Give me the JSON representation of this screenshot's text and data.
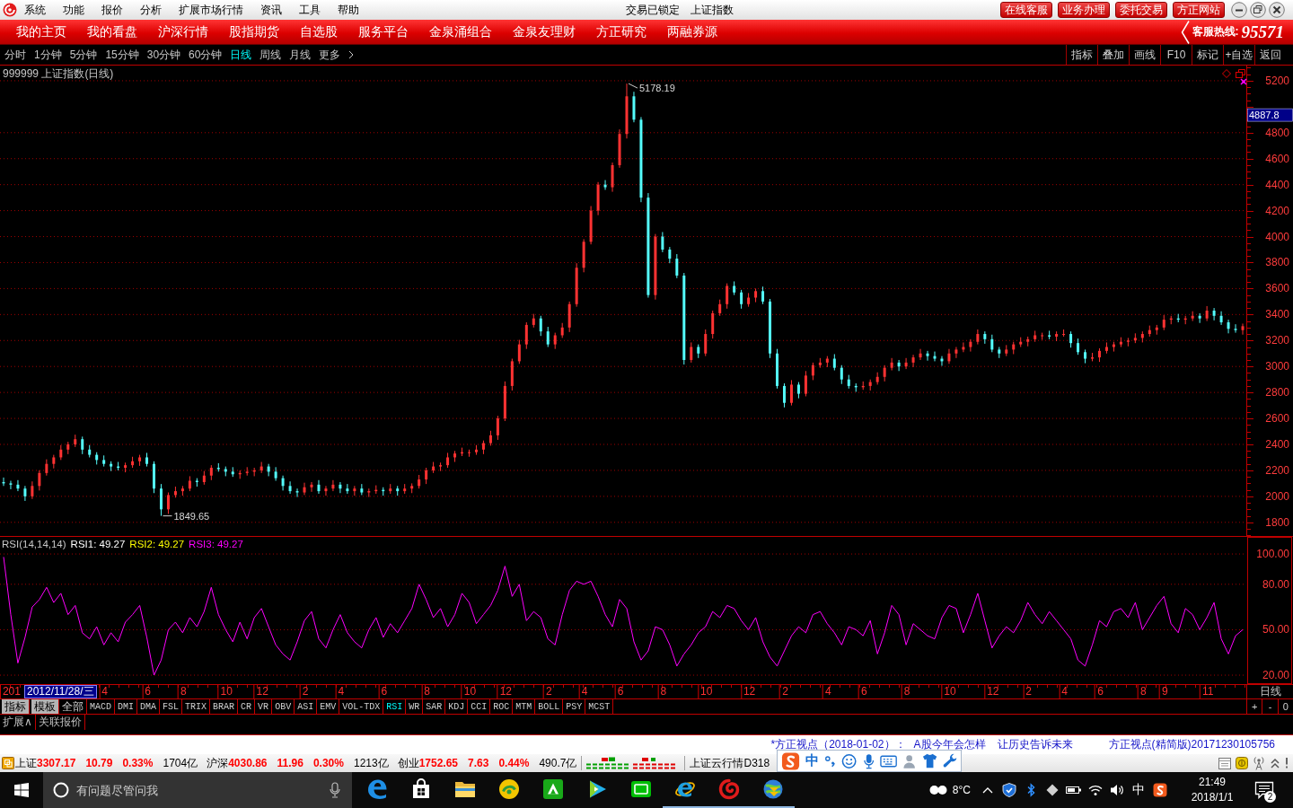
{
  "title_bar": {
    "menu": [
      "系统",
      "功能",
      "报价",
      "分析",
      "扩展市场行情",
      "资讯",
      "工具",
      "帮助"
    ],
    "lock_status": "交易已锁定",
    "security": "上证指数",
    "service_buttons": [
      "在线客服",
      "业务办理",
      "委托交易",
      "方正网站"
    ]
  },
  "nav_bar": {
    "items": [
      "我的主页",
      "我的看盘",
      "沪深行情",
      "股指期货",
      "自选股",
      "服务平台",
      "金泉涌组合",
      "金泉友理财",
      "方正研究",
      "两融券源"
    ],
    "hotline_label": "客服热线:",
    "hotline_number": "95571"
  },
  "period_bar": {
    "periods": [
      {
        "label": "分时",
        "selected": false
      },
      {
        "label": "1分钟",
        "selected": false
      },
      {
        "label": "5分钟",
        "selected": false
      },
      {
        "label": "15分钟",
        "selected": false
      },
      {
        "label": "30分钟",
        "selected": false
      },
      {
        "label": "60分钟",
        "selected": false
      },
      {
        "label": "日线",
        "selected": true
      },
      {
        "label": "周线",
        "selected": false
      },
      {
        "label": "月线",
        "selected": false
      },
      {
        "label": "更多",
        "selected": false
      }
    ],
    "tools": [
      "指标",
      "叠加",
      "画线",
      "F10",
      "标记",
      "+自选",
      "返回"
    ]
  },
  "price_chart": {
    "cursor_value": "4887.8",
    "chart_data": {
      "type": "candlestick",
      "title": "999999 上证指数(日线)",
      "categories": [
        null,
        null,
        null,
        null,
        null,
        null,
        null,
        null,
        null,
        null,
        null,
        null,
        null,
        null,
        null,
        null,
        null,
        null,
        null,
        null,
        null,
        null,
        null,
        null,
        null,
        null,
        null,
        null,
        null,
        null,
        null,
        null,
        null,
        null,
        null,
        null,
        null,
        null,
        null,
        null,
        null,
        null,
        null,
        null,
        null,
        null,
        null,
        null,
        null,
        null,
        null,
        null,
        null,
        null,
        null,
        null,
        null,
        null,
        null,
        null,
        null,
        null,
        null,
        null,
        null,
        null,
        null,
        null,
        null,
        null,
        null,
        null,
        null,
        null,
        null,
        null,
        null,
        null,
        null,
        null,
        null,
        null,
        null,
        null,
        null,
        null,
        null,
        null,
        null,
        null,
        null,
        null,
        null,
        null,
        null,
        null,
        null,
        null,
        null,
        null,
        null,
        null,
        null,
        null,
        null,
        null,
        null,
        null,
        null,
        null,
        null,
        null,
        null,
        null,
        null,
        null,
        null,
        null,
        null,
        null,
        null,
        null,
        null,
        null,
        null,
        null,
        null,
        null,
        null,
        null,
        null,
        null,
        null,
        null,
        null,
        null,
        null,
        null,
        null,
        null,
        null,
        null,
        null,
        null,
        null,
        null,
        null,
        null,
        null,
        null,
        null,
        null,
        null,
        null,
        null,
        null,
        null,
        null,
        null,
        null,
        null,
        null,
        null,
        null,
        null,
        null,
        null,
        null,
        null,
        null,
        null,
        null,
        null,
        null
      ],
      "ohlc": [
        [
          2110,
          2145,
          2080,
          2100
        ],
        [
          2100,
          2120,
          2055,
          2090
        ],
        [
          2090,
          2125,
          2040,
          2060
        ],
        [
          2060,
          2080,
          1965,
          2000
        ],
        [
          2000,
          2115,
          1980,
          2080
        ],
        [
          2080,
          2200,
          2045,
          2180
        ],
        [
          2180,
          2285,
          2160,
          2250
        ],
        [
          2250,
          2320,
          2215,
          2300
        ],
        [
          2300,
          2395,
          2280,
          2360
        ],
        [
          2360,
          2420,
          2325,
          2400
        ],
        [
          2400,
          2475,
          2380,
          2440
        ],
        [
          2440,
          2460,
          2325,
          2360
        ],
        [
          2360,
          2395,
          2300,
          2320
        ],
        [
          2320,
          2340,
          2245,
          2280
        ],
        [
          2280,
          2315,
          2230,
          2250
        ],
        [
          2250,
          2270,
          2195,
          2230
        ],
        [
          2230,
          2265,
          2200,
          2220
        ],
        [
          2220,
          2260,
          2185,
          2240
        ],
        [
          2240,
          2305,
          2220,
          2270
        ],
        [
          2270,
          2320,
          2235,
          2300
        ],
        [
          2300,
          2335,
          2230,
          2250
        ],
        [
          2250,
          2270,
          2025,
          2060
        ],
        [
          2060,
          2095,
          1849.65,
          1900
        ],
        [
          1900,
          2030,
          1865,
          2010
        ],
        [
          2010,
          2075,
          1990,
          2040
        ],
        [
          2040,
          2080,
          2005,
          2060
        ],
        [
          2060,
          2155,
          2040,
          2120
        ],
        [
          2120,
          2140,
          2075,
          2110
        ],
        [
          2110,
          2195,
          2090,
          2160
        ],
        [
          2160,
          2240,
          2125,
          2220
        ],
        [
          2220,
          2255,
          2190,
          2210
        ],
        [
          2210,
          2230,
          2155,
          2190
        ],
        [
          2190,
          2225,
          2150,
          2170
        ],
        [
          2170,
          2200,
          2135,
          2180
        ],
        [
          2180,
          2225,
          2160,
          2190
        ],
        [
          2190,
          2220,
          2155,
          2200
        ],
        [
          2200,
          2265,
          2180,
          2230
        ],
        [
          2230,
          2250,
          2155,
          2190
        ],
        [
          2190,
          2225,
          2120,
          2140
        ],
        [
          2140,
          2160,
          2045,
          2080
        ],
        [
          2080,
          2115,
          2020,
          2040
        ],
        [
          2040,
          2060,
          1995,
          2030
        ],
        [
          2030,
          2105,
          2010,
          2070
        ],
        [
          2070,
          2110,
          2035,
          2090
        ],
        [
          2090,
          2125,
          2020,
          2040
        ],
        [
          2040,
          2080,
          2005,
          2060
        ],
        [
          2060,
          2125,
          2040,
          2090
        ],
        [
          2090,
          2110,
          2025,
          2060
        ],
        [
          2060,
          2095,
          2020,
          2040
        ],
        [
          2040,
          2080,
          2005,
          2060
        ],
        [
          2060,
          2095,
          2010,
          2030
        ],
        [
          2030,
          2060,
          1995,
          2040
        ],
        [
          2040,
          2085,
          2020,
          2050
        ],
        [
          2050,
          2070,
          2005,
          2040
        ],
        [
          2040,
          2095,
          2020,
          2060
        ],
        [
          2060,
          2080,
          2005,
          2040
        ],
        [
          2040,
          2095,
          2020,
          2060
        ],
        [
          2060,
          2100,
          2025,
          2080
        ],
        [
          2080,
          2165,
          2060,
          2130
        ],
        [
          2130,
          2220,
          2095,
          2200
        ],
        [
          2200,
          2265,
          2180,
          2230
        ],
        [
          2230,
          2260,
          2195,
          2240
        ],
        [
          2240,
          2335,
          2220,
          2300
        ],
        [
          2300,
          2350,
          2265,
          2330
        ],
        [
          2330,
          2375,
          2310,
          2340
        ],
        [
          2340,
          2360,
          2305,
          2340
        ],
        [
          2340,
          2395,
          2320,
          2360
        ],
        [
          2360,
          2430,
          2325,
          2410
        ],
        [
          2410,
          2505,
          2390,
          2470
        ],
        [
          2470,
          2620,
          2435,
          2600
        ],
        [
          2600,
          2885,
          2580,
          2850
        ],
        [
          2850,
          3060,
          2815,
          3040
        ],
        [
          3040,
          3205,
          3020,
          3170
        ],
        [
          3170,
          3340,
          3135,
          3320
        ],
        [
          3320,
          3405,
          3300,
          3370
        ],
        [
          3370,
          3390,
          3235,
          3270
        ],
        [
          3270,
          3305,
          3150,
          3170
        ],
        [
          3170,
          3260,
          3135,
          3240
        ],
        [
          3240,
          3335,
          3220,
          3300
        ],
        [
          3300,
          3500,
          3265,
          3480
        ],
        [
          3480,
          3795,
          3460,
          3760
        ],
        [
          3760,
          3980,
          3725,
          3960
        ],
        [
          3960,
          4235,
          3940,
          4200
        ],
        [
          4200,
          4420,
          4165,
          4400
        ],
        [
          4400,
          4435,
          4360,
          4380
        ],
        [
          4380,
          4570,
          4345,
          4550
        ],
        [
          4550,
          4825,
          4530,
          4790
        ],
        [
          4790,
          5178.19,
          4755,
          5080
        ],
        [
          5080,
          5115,
          4880,
          4900
        ],
        [
          4900,
          4920,
          4265,
          4300
        ],
        [
          4300,
          4335,
          3530,
          3550
        ],
        [
          3550,
          4020,
          3515,
          4000
        ],
        [
          4000,
          4035,
          3880,
          3900
        ],
        [
          3900,
          3920,
          3795,
          3830
        ],
        [
          3830,
          3865,
          3680,
          3700
        ],
        [
          3700,
          3720,
          3015,
          3050
        ],
        [
          3050,
          3185,
          3030,
          3150
        ],
        [
          3150,
          3170,
          3065,
          3100
        ],
        [
          3100,
          3285,
          3080,
          3250
        ],
        [
          3250,
          3430,
          3215,
          3410
        ],
        [
          3410,
          3515,
          3390,
          3480
        ],
        [
          3480,
          3640,
          3445,
          3620
        ],
        [
          3620,
          3655,
          3550,
          3570
        ],
        [
          3570,
          3590,
          3445,
          3480
        ],
        [
          3480,
          3565,
          3460,
          3530
        ],
        [
          3530,
          3600,
          3495,
          3580
        ],
        [
          3580,
          3615,
          3480,
          3500
        ],
        [
          3500,
          3520,
          3065,
          3100
        ],
        [
          3100,
          3135,
          2830,
          2850
        ],
        [
          2850,
          2870,
          2685,
          2720
        ],
        [
          2720,
          2895,
          2700,
          2860
        ],
        [
          2860,
          2880,
          2755,
          2790
        ],
        [
          2790,
          2965,
          2770,
          2930
        ],
        [
          2930,
          3030,
          2895,
          3010
        ],
        [
          3010,
          3065,
          2990,
          3030
        ],
        [
          3030,
          3080,
          2995,
          3060
        ],
        [
          3060,
          3095,
          2970,
          2990
        ],
        [
          2990,
          3010,
          2865,
          2900
        ],
        [
          2900,
          2935,
          2830,
          2850
        ],
        [
          2850,
          2870,
          2805,
          2840
        ],
        [
          2840,
          2885,
          2820,
          2850
        ],
        [
          2850,
          2900,
          2815,
          2880
        ],
        [
          2880,
          2955,
          2860,
          2920
        ],
        [
          2920,
          3010,
          2885,
          2990
        ],
        [
          2990,
          3065,
          2970,
          3030
        ],
        [
          3030,
          3050,
          2965,
          3000
        ],
        [
          3000,
          3065,
          2980,
          3030
        ],
        [
          3030,
          3090,
          2995,
          3070
        ],
        [
          3070,
          3135,
          3050,
          3100
        ],
        [
          3100,
          3120,
          3045,
          3080
        ],
        [
          3080,
          3115,
          3040,
          3060
        ],
        [
          3060,
          3080,
          3005,
          3040
        ],
        [
          3040,
          3135,
          3020,
          3100
        ],
        [
          3100,
          3150,
          3065,
          3130
        ],
        [
          3130,
          3185,
          3110,
          3150
        ],
        [
          3150,
          3210,
          3115,
          3190
        ],
        [
          3190,
          3285,
          3170,
          3250
        ],
        [
          3250,
          3270,
          3175,
          3210
        ],
        [
          3210,
          3245,
          3110,
          3130
        ],
        [
          3130,
          3150,
          3065,
          3100
        ],
        [
          3100,
          3165,
          3080,
          3130
        ],
        [
          3130,
          3190,
          3095,
          3170
        ],
        [
          3170,
          3225,
          3150,
          3190
        ],
        [
          3190,
          3230,
          3155,
          3210
        ],
        [
          3210,
          3275,
          3190,
          3240
        ],
        [
          3240,
          3260,
          3205,
          3240
        ],
        [
          3240,
          3275,
          3210,
          3230
        ],
        [
          3230,
          3270,
          3195,
          3250
        ],
        [
          3250,
          3285,
          3230,
          3250
        ],
        [
          3250,
          3270,
          3145,
          3180
        ],
        [
          3180,
          3215,
          3090,
          3110
        ],
        [
          3110,
          3130,
          3025,
          3060
        ],
        [
          3060,
          3105,
          3040,
          3070
        ],
        [
          3070,
          3140,
          3035,
          3120
        ],
        [
          3120,
          3185,
          3100,
          3150
        ],
        [
          3150,
          3190,
          3115,
          3170
        ],
        [
          3170,
          3225,
          3150,
          3190
        ],
        [
          3190,
          3220,
          3155,
          3200
        ],
        [
          3200,
          3255,
          3180,
          3220
        ],
        [
          3220,
          3270,
          3185,
          3250
        ],
        [
          3250,
          3315,
          3230,
          3280
        ],
        [
          3280,
          3320,
          3245,
          3300
        ],
        [
          3300,
          3395,
          3280,
          3360
        ],
        [
          3360,
          3390,
          3325,
          3370
        ],
        [
          3370,
          3405,
          3340,
          3360
        ],
        [
          3360,
          3390,
          3325,
          3370
        ],
        [
          3370,
          3425,
          3350,
          3390
        ],
        [
          3390,
          3410,
          3335,
          3370
        ],
        [
          3370,
          3465,
          3350,
          3430
        ],
        [
          3430,
          3450,
          3355,
          3390
        ],
        [
          3390,
          3425,
          3320,
          3340
        ],
        [
          3340,
          3360,
          3255,
          3290
        ],
        [
          3290,
          3325,
          3260,
          3280
        ],
        [
          3280,
          3330,
          3245,
          3310
        ]
      ],
      "ylim": [
        1695,
        5317
      ],
      "yticks": [
        1800,
        2000,
        2200,
        2400,
        2600,
        2800,
        3000,
        3200,
        3400,
        3600,
        3800,
        4000,
        4200,
        4400,
        4600,
        4800,
        5200
      ],
      "grid": true,
      "annotations": [
        "5178.19",
        "1849.65"
      ]
    }
  },
  "rsi_panel": {
    "legend": [
      {
        "label": "RSI1: 49.27",
        "color": "#ffffff"
      },
      {
        "label": "RSI2: 49.27",
        "color": "#ffff00"
      },
      {
        "label": "RSI3: 49.27",
        "color": "#ff00ff"
      }
    ],
    "chart_data": {
      "type": "line",
      "title": "RSI(14,14,14)",
      "categories": [
        null,
        "201",
        null,
        null,
        null,
        null,
        null,
        null,
        null,
        null,
        null,
        null,
        null,
        null,
        "4",
        null,
        null,
        null,
        null,
        null,
        "6",
        null,
        null,
        null,
        null,
        "8",
        null,
        null,
        null,
        null,
        null,
        "10",
        null,
        null,
        null,
        null,
        "12",
        null,
        null,
        null,
        null,
        null,
        "2",
        null,
        null,
        null,
        null,
        "4",
        null,
        null,
        null,
        null,
        null,
        "6",
        null,
        null,
        null,
        null,
        null,
        "8",
        null,
        null,
        null,
        null,
        null,
        "10",
        null,
        null,
        null,
        null,
        "12",
        null,
        null,
        null,
        null,
        null,
        "2",
        null,
        null,
        null,
        null,
        "4",
        null,
        null,
        null,
        null,
        "6",
        null,
        null,
        null,
        null,
        null,
        "8",
        null,
        null,
        null,
        null,
        null,
        "10",
        null,
        null,
        null,
        null,
        null,
        "12",
        null,
        null,
        null,
        null,
        "2",
        null,
        null,
        null,
        null,
        null,
        "4",
        null,
        null,
        null,
        null,
        "6",
        null,
        null,
        null,
        null,
        null,
        "8",
        null,
        null,
        null,
        null,
        null,
        "10",
        null,
        null,
        null,
        null,
        null,
        "12",
        null,
        null,
        null,
        null,
        "2",
        null,
        null,
        null,
        null,
        "4",
        null,
        null,
        null,
        null,
        "6",
        null,
        null,
        null,
        null,
        null,
        "8",
        null,
        null,
        "9",
        null,
        null,
        null,
        null,
        null,
        "11",
        null,
        null,
        null,
        null,
        null
      ],
      "series": [
        {
          "color": "#ff00ff",
          "values": [
            98,
            60,
            28,
            45,
            65,
            70,
            78,
            68,
            74,
            60,
            66,
            48,
            44,
            52,
            40,
            48,
            42,
            55,
            60,
            66,
            45,
            20,
            30,
            50,
            55,
            48,
            58,
            52,
            62,
            78,
            60,
            50,
            42,
            55,
            44,
            58,
            64,
            52,
            40,
            34,
            30,
            42,
            56,
            62,
            44,
            38,
            50,
            60,
            48,
            42,
            38,
            50,
            58,
            45,
            54,
            48,
            56,
            64,
            80,
            70,
            58,
            64,
            52,
            60,
            74,
            68,
            54,
            60,
            66,
            76,
            92,
            72,
            80,
            56,
            62,
            58,
            44,
            40,
            60,
            76,
            82,
            80,
            82,
            72,
            60,
            52,
            70,
            64,
            42,
            30,
            36,
            52,
            50,
            40,
            26,
            34,
            40,
            48,
            52,
            62,
            58,
            66,
            64,
            56,
            50,
            58,
            42,
            32,
            26,
            36,
            46,
            52,
            48,
            60,
            62,
            54,
            48,
            40,
            52,
            50,
            46,
            56,
            34,
            48,
            66,
            60,
            40,
            54,
            50,
            46,
            44,
            58,
            66,
            64,
            48,
            60,
            74,
            56,
            38,
            46,
            52,
            48,
            56,
            68,
            60,
            54,
            62,
            56,
            50,
            44,
            30,
            26,
            40,
            56,
            52,
            62,
            64,
            58,
            68,
            50,
            58,
            66,
            72,
            54,
            48,
            64,
            60,
            50,
            58,
            68,
            44,
            34,
            46,
            50
          ]
        }
      ],
      "ylim": [
        14.1,
        111.3
      ],
      "yticks": [
        {
          "value": 20,
          "label": "20.00"
        },
        {
          "value": 50,
          "label": "50.00"
        },
        {
          "value": 80,
          "label": "80.00"
        },
        {
          "value": 100,
          "label": "100.00"
        }
      ],
      "grid": true
    }
  },
  "time_axis": {
    "cursor_date": "2012/11/28/三",
    "period": "日线"
  },
  "indicator_bar": {
    "buttons": [
      "指标",
      "模板"
    ],
    "all_tab": {
      "label": "全部",
      "selected": false
    },
    "indicators": [
      {
        "label": "MACD",
        "selected": false
      },
      {
        "label": "DMI",
        "selected": false
      },
      {
        "label": "DMA",
        "selected": false
      },
      {
        "label": "FSL",
        "selected": false
      },
      {
        "label": "TRIX",
        "selected": false
      },
      {
        "label": "BRAR",
        "selected": false
      },
      {
        "label": "CR",
        "selected": false
      },
      {
        "label": "VR",
        "selected": false
      },
      {
        "label": "OBV",
        "selected": false
      },
      {
        "label": "ASI",
        "selected": false
      },
      {
        "label": "EMV",
        "selected": false
      },
      {
        "label": "VOL-TDX",
        "selected": false
      },
      {
        "label": "RSI",
        "selected": true
      },
      {
        "label": "WR",
        "selected": false
      },
      {
        "label": "SAR",
        "selected": false
      },
      {
        "label": "KDJ",
        "selected": false
      },
      {
        "label": "CCI",
        "selected": false
      },
      {
        "label": "ROC",
        "selected": false
      },
      {
        "label": "MTM",
        "selected": false
      },
      {
        "label": "BOLL",
        "selected": false
      },
      {
        "label": "PSY",
        "selected": false
      },
      {
        "label": "MCST",
        "selected": false
      }
    ],
    "zoom_buttons": [
      "+",
      "-",
      "0"
    ]
  },
  "extension_bar": {
    "buttons": [
      "扩展∧",
      "关联报价"
    ]
  },
  "news_ticker": {
    "source": "*方正视点（2018-01-02）：",
    "headlines": [
      "A股今年会怎样",
      "让历史告诉未来"
    ],
    "edition": "方正视点(精简版)20171230105756"
  },
  "status_bar": {
    "indices": [
      {
        "name": "上证",
        "value": "3307.17",
        "change": "10.79",
        "percent": "0.33%",
        "turnover": "1704亿",
        "rising": true
      },
      {
        "name": "沪深",
        "value": "4030.86",
        "change": "11.96",
        "percent": "0.30%",
        "turnover": "1213亿",
        "rising": true
      },
      {
        "name": "创业",
        "value": "1752.65",
        "change": "7.63",
        "percent": "0.44%",
        "turnover": "490.7亿",
        "rising": true
      }
    ],
    "cloud_label": "上证云行情D318",
    "ime_mode": "中"
  },
  "taskbar": {
    "search_placeholder": "有问题尽管问我",
    "apps": [
      {
        "kind": "edge",
        "running": false
      },
      {
        "kind": "store",
        "running": false
      },
      {
        "kind": "explorer",
        "running": false
      },
      {
        "kind": "disc",
        "running": false
      },
      {
        "kind": "tile",
        "running": false
      },
      {
        "kind": "video",
        "running": false
      },
      {
        "kind": "tv",
        "running": false
      },
      {
        "kind": "ie",
        "running": true
      },
      {
        "kind": "swirl",
        "running": true
      },
      {
        "kind": "globe",
        "running": true
      }
    ],
    "temperature": "8°C",
    "input_mode": "中",
    "time": "21:49",
    "date": "2018/1/1",
    "notification_count": "2"
  }
}
